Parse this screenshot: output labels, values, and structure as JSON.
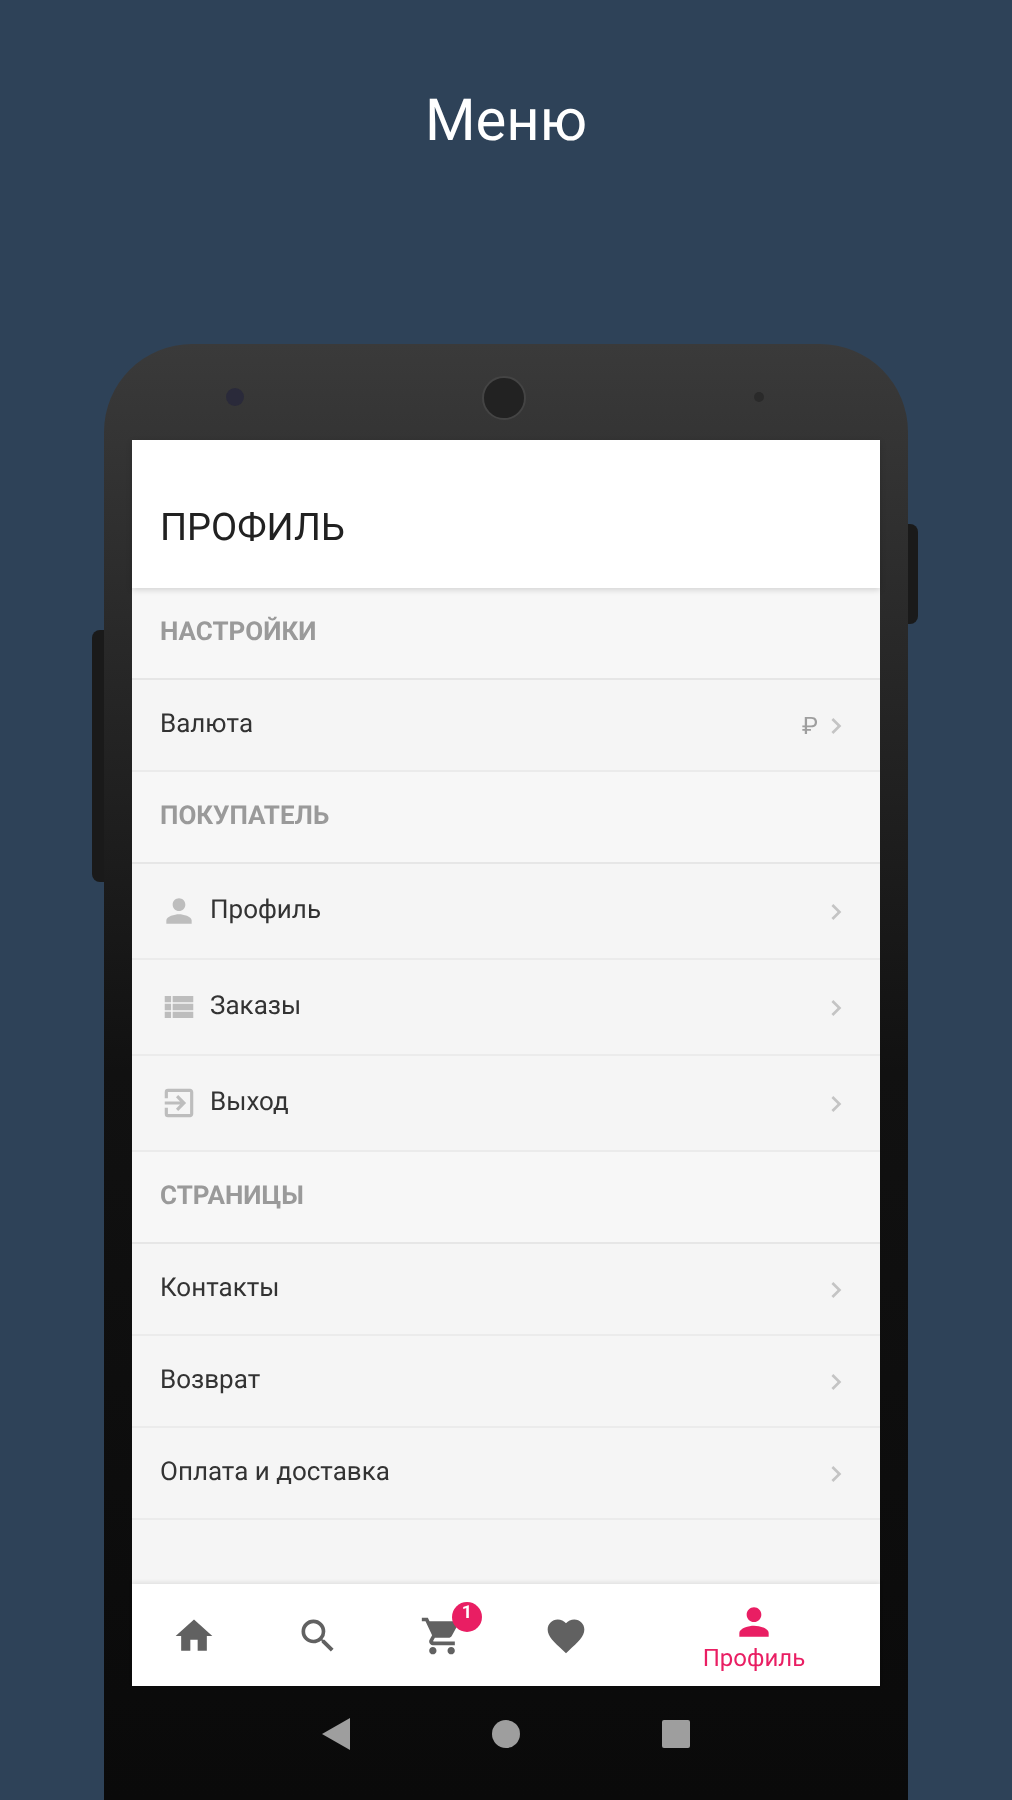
{
  "title": "Меню",
  "screen": {
    "header": "ПРОФИЛЬ",
    "sections": [
      {
        "title": "НАСТРОЙКИ",
        "items": [
          {
            "label": "Валюта",
            "value": "₽"
          }
        ]
      },
      {
        "title": "ПОКУПАТЕЛЬ",
        "items": [
          {
            "label": "Профиль"
          },
          {
            "label": "Заказы"
          },
          {
            "label": "Выход"
          }
        ]
      },
      {
        "title": "СТРАНИЦЫ",
        "items": [
          {
            "label": "Контакты"
          },
          {
            "label": "Возврат"
          },
          {
            "label": "Оплата и доставка"
          }
        ]
      }
    ]
  },
  "bottom_nav": [
    {
      "selected": false
    },
    {
      "selected": false
    },
    {
      "selected": false,
      "badge": "1"
    },
    {
      "selected": false
    },
    {
      "selected": true,
      "label": "Профиль"
    }
  ]
}
